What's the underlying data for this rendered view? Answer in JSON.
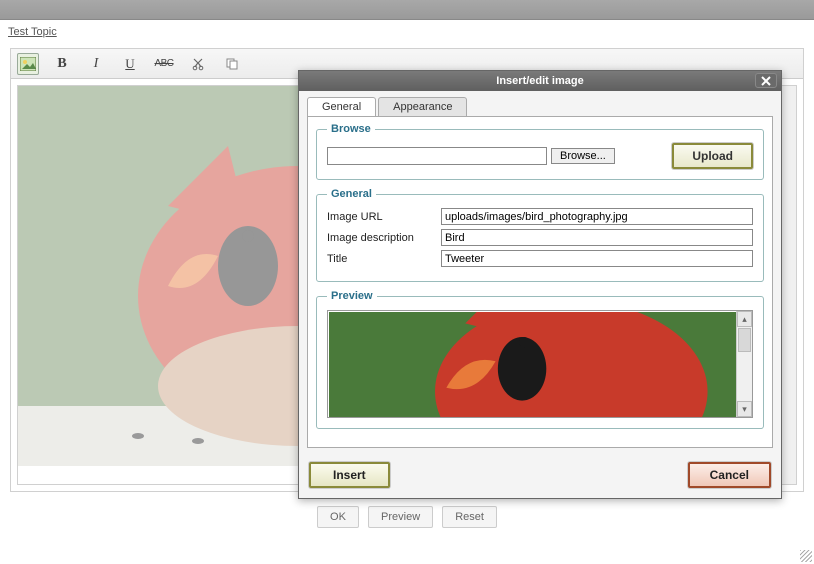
{
  "breadcrumb": {
    "link": "Test Topic"
  },
  "dialog": {
    "title": "Insert/edit image",
    "tabs": {
      "general": "General",
      "appearance": "Appearance"
    },
    "browse": {
      "legend": "Browse",
      "browse_btn": "Browse...",
      "upload_btn": "Upload"
    },
    "general": {
      "legend": "General",
      "url_label": "Image URL",
      "url_value": "uploads/images/bird_photography.jpg",
      "desc_label": "Image description",
      "desc_value": "Bird",
      "title_label": "Title",
      "title_value": "Tweeter"
    },
    "preview_legend": "Preview",
    "insert_btn": "Insert",
    "cancel_btn": "Cancel"
  },
  "footer": {
    "ok": "OK",
    "preview": "Preview",
    "reset": "Reset"
  }
}
